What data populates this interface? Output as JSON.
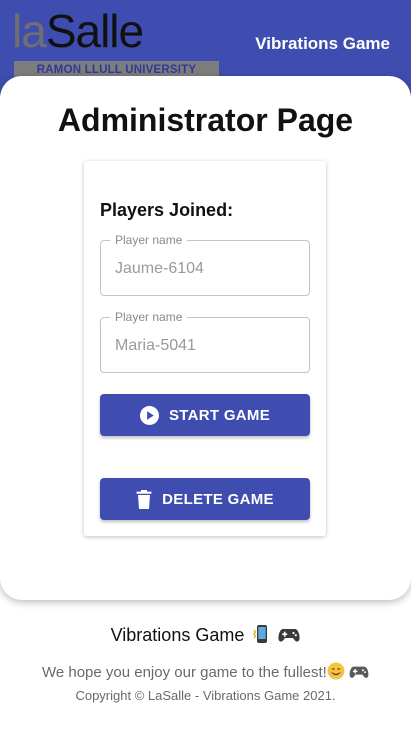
{
  "header": {
    "logo_la": "la",
    "logo_salle": "Salle",
    "logo_subtitle": "RAMON LLULL UNIVERSITY",
    "app_title": "Vibrations Game",
    "background_color": "#3f4db0"
  },
  "main": {
    "page_title": "Administrator Page",
    "players_heading": "Players Joined:",
    "players": [
      {
        "label": "Player name",
        "value": "Jaume-6104"
      },
      {
        "label": "Player name",
        "value": "Maria-5041"
      }
    ],
    "start_button": {
      "label": "START GAME",
      "icon": "play-circle-icon"
    },
    "delete_button": {
      "label": "DELETE GAME",
      "icon": "trash-icon"
    }
  },
  "footer": {
    "title": "Vibrations Game",
    "title_emojis": [
      "phone-vibrate-icon",
      "gamepad-icon"
    ],
    "message": "We hope you enjoy our game to the fullest!",
    "message_emojis": [
      "smiling-face-icon",
      "gamepad-icon"
    ],
    "copyright": "Copyright © LaSalle - Vibrations Game 2021."
  }
}
